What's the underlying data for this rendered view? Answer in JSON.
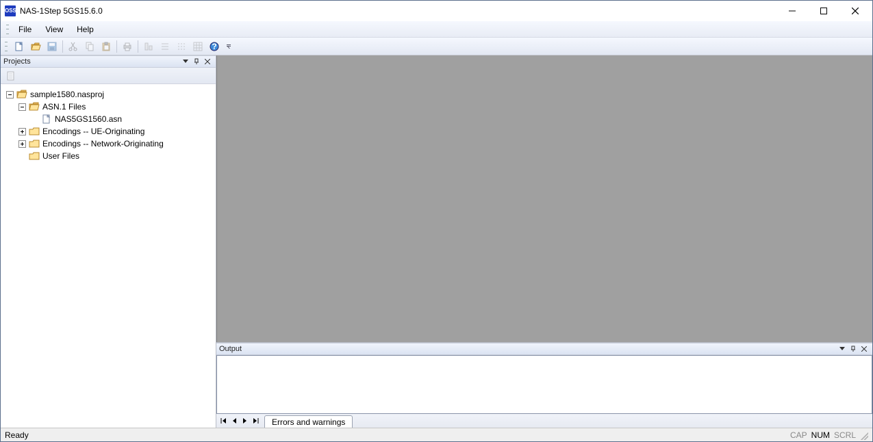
{
  "app_icon_text": "OSS",
  "title": "NAS-1Step 5GS15.6.0",
  "menu": {
    "file": "File",
    "view": "View",
    "help": "Help"
  },
  "panels": {
    "projects_title": "Projects",
    "output_title": "Output",
    "output_tab": "Errors and warnings"
  },
  "tree": {
    "root": "sample1580.nasproj",
    "asn_folder": "ASN.1 Files",
    "asn_file": "NAS5GS1560.asn",
    "enc_ue": "Encodings -- UE-Originating",
    "enc_net": "Encodings -- Network-Originating",
    "user_files": "User Files"
  },
  "status": {
    "ready": "Ready",
    "cap": "CAP",
    "num": "NUM",
    "scrl": "SCRL"
  },
  "icons": {
    "new": "new-file-icon",
    "open": "open-folder-icon",
    "save": "save-icon",
    "cut": "cut-icon",
    "copy": "copy-icon",
    "paste": "paste-icon",
    "print": "print-icon",
    "list": "list-icon",
    "grid": "grid-icon",
    "help": "help-icon"
  }
}
